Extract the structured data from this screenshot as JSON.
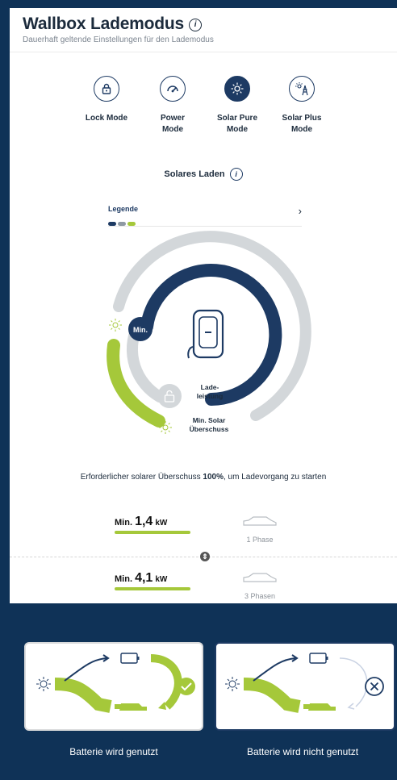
{
  "header": {
    "title": "Wallbox Lademodus",
    "subtitle": "Dauerhaft geltende Einstellungen für den Lademodus"
  },
  "modes": [
    {
      "line1": "Lock Mode",
      "line2": "",
      "icon": "lock-icon",
      "active": false
    },
    {
      "line1": "Power",
      "line2": "Mode",
      "icon": "speedometer-icon",
      "active": false
    },
    {
      "line1": "Solar Pure",
      "line2": "Mode",
      "icon": "sun-icon",
      "active": true
    },
    {
      "line1": "Solar Plus",
      "line2": "Mode",
      "icon": "sun-pylon-icon",
      "active": false
    }
  ],
  "section": {
    "title": "Solares Laden"
  },
  "legend": {
    "label": "Legende",
    "colors": [
      "#1d3a63",
      "#8e99a3",
      "#a5c83a"
    ]
  },
  "gauge": {
    "min_badge": "Min.",
    "lade_line1": "Lade-",
    "lade_line2": "leistung",
    "solar_line1": "Min. Solar",
    "solar_line2": "Überschuss",
    "colors": {
      "outer": "#d3d7da",
      "blue": "#1d3a63",
      "green": "#a5c83a"
    }
  },
  "caption": {
    "pre": "Erforderlicher solarer Überschuss ",
    "value": "100%",
    "post": ", um Ladevorgang zu starten"
  },
  "power_rows": [
    {
      "min": "Min.",
      "value": "1,4",
      "unit": "kW",
      "phase": "1 Phase"
    },
    {
      "min": "Min.",
      "value": "4,1",
      "unit": "kW",
      "phase": "3 Phasen"
    }
  ],
  "battery_cards": [
    {
      "label": "Batterie wird genutzt",
      "status": "check-icon"
    },
    {
      "label": "Batterie wird nicht genutzt",
      "status": "x-circle-icon"
    }
  ]
}
